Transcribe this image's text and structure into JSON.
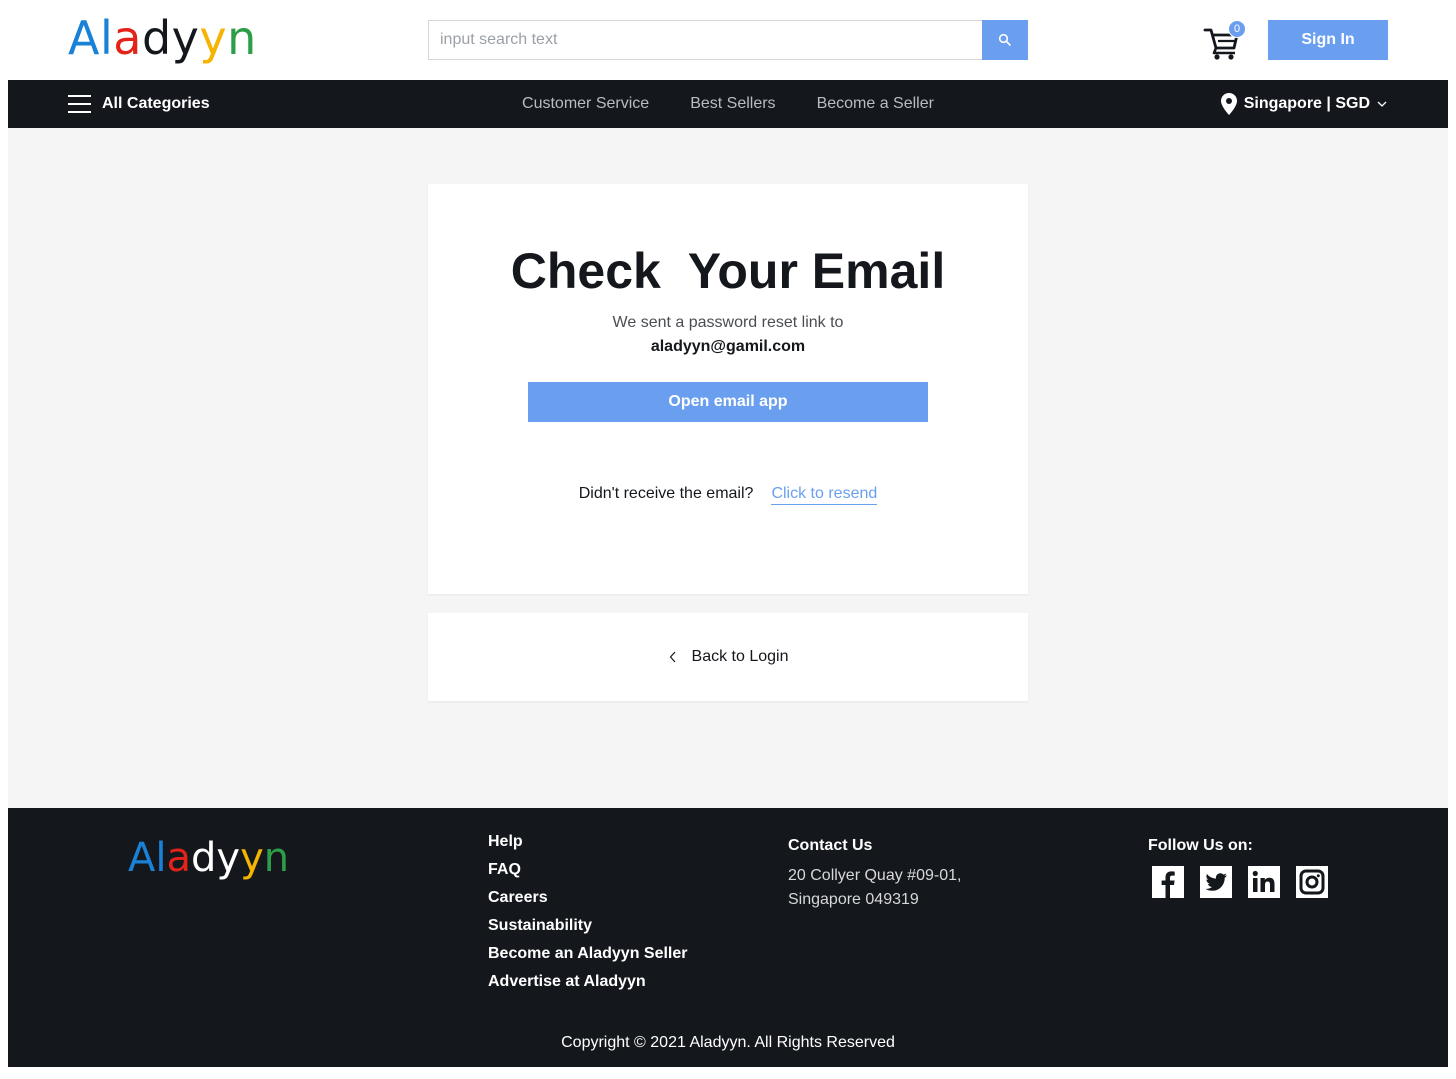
{
  "brand": {
    "letters": [
      "A",
      "l",
      "a",
      "d",
      "y",
      "y",
      "n"
    ],
    "letter_colors": [
      "#1a82d6",
      "#1a82d6",
      "#e32219",
      "#14171c",
      "#14171c",
      "#f4b400",
      "#2c9e48"
    ],
    "footer_letter_colors": [
      "#1a82d6",
      "#1a82d6",
      "#e32219",
      "#ffffff",
      "#ffffff",
      "#f4b400",
      "#2c9e48"
    ]
  },
  "header": {
    "search_placeholder": "input search text",
    "search_icon": "search-icon",
    "cart_count": "0",
    "sign_in_label": "Sign In"
  },
  "nav": {
    "all_categories": "All Categories",
    "links": [
      "Customer Service",
      "Best Sellers",
      "Become a Seller"
    ],
    "locale": "Singapore | SGD"
  },
  "main": {
    "title": "Check  Your Email",
    "subtitle": "We sent a password reset link to",
    "email": "aladyyn@gamil.com",
    "open_button": "Open email app",
    "resend_question": "Didn't receive the email?",
    "resend_link": "Click to resend",
    "back_label": "Back to Login"
  },
  "footer": {
    "links": [
      "Help",
      "FAQ",
      "Careers",
      "Sustainability",
      "Become an Aladyyn Seller",
      "Advertise at Aladyyn"
    ],
    "contact_title": "Contact Us",
    "address_line1": "20 Collyer Quay #09-01,",
    "address_line2": "Singapore 049319",
    "follow_title": "Follow Us on:",
    "socials": [
      "facebook-icon",
      "twitter-icon",
      "linkedin-icon",
      "instagram-icon"
    ],
    "copyright": "Copyright © 2021 Aladyyn. All Rights Reserved"
  },
  "colors": {
    "accent": "#6a9ff0",
    "dark": "#14171c",
    "background": "#f5f5f5"
  }
}
